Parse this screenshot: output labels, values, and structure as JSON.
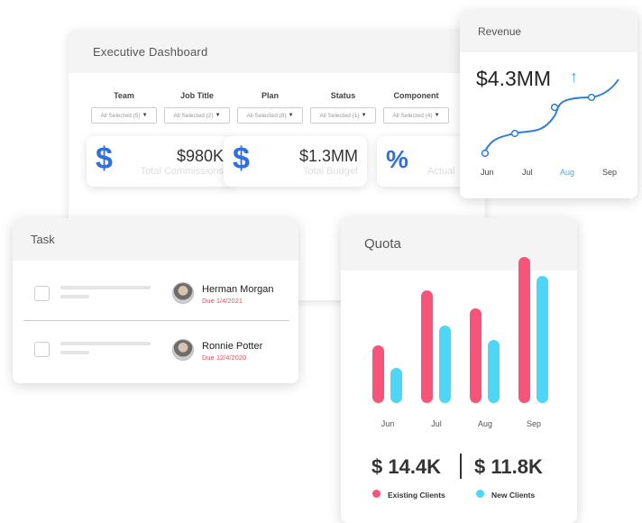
{
  "executive": {
    "title": "Executive Dashboard",
    "filters": [
      {
        "label": "Team",
        "value": "All Selected (5)"
      },
      {
        "label": "Job Title",
        "value": "All Selected (2)"
      },
      {
        "label": "Plan",
        "value": "All Selected (8)"
      },
      {
        "label": "Status",
        "value": "All Selected (1)"
      },
      {
        "label": "Component",
        "value": "All Selected (4)"
      }
    ],
    "kpis": [
      {
        "icon": "$",
        "value": "$980K",
        "label": "Total Commissions"
      },
      {
        "icon": "$",
        "value": "$1.3MM",
        "label": "Total Budget"
      },
      {
        "icon": "%",
        "value": "",
        "label": "Actual"
      }
    ]
  },
  "revenue": {
    "title": "Revenue",
    "value": "$4.3MM",
    "trend_icon": "up-arrow-icon",
    "months": [
      "Jun",
      "Jul",
      "Aug",
      "Sep"
    ],
    "highlight_month": "Aug",
    "accent_color": "#42a5f5"
  },
  "task": {
    "title": "Task",
    "items": [
      {
        "name": "Herman Morgan",
        "due": "Due 1/4/2021"
      },
      {
        "name": "Ronnie Potter",
        "due": "Due 12/4/2020"
      }
    ]
  },
  "quota": {
    "title": "Quota",
    "existing_total": "$ 14.4K",
    "new_total": "$ 11.8K",
    "legend_existing": "Existing Clients",
    "legend_new": "New Clients"
  },
  "chart_data": {
    "type": "bar",
    "categories": [
      "Jun",
      "Jul",
      "Aug",
      "Sep"
    ],
    "series": [
      {
        "name": "Existing Clients",
        "color": "#f7547a",
        "values": [
          66,
          128,
          108,
          166
        ]
      },
      {
        "name": "New Clients",
        "color": "#4dd6f5",
        "values": [
          40,
          88,
          72,
          144
        ]
      }
    ],
    "ylim": [
      0,
      170
    ],
    "grid": false,
    "legend": "bottom"
  }
}
